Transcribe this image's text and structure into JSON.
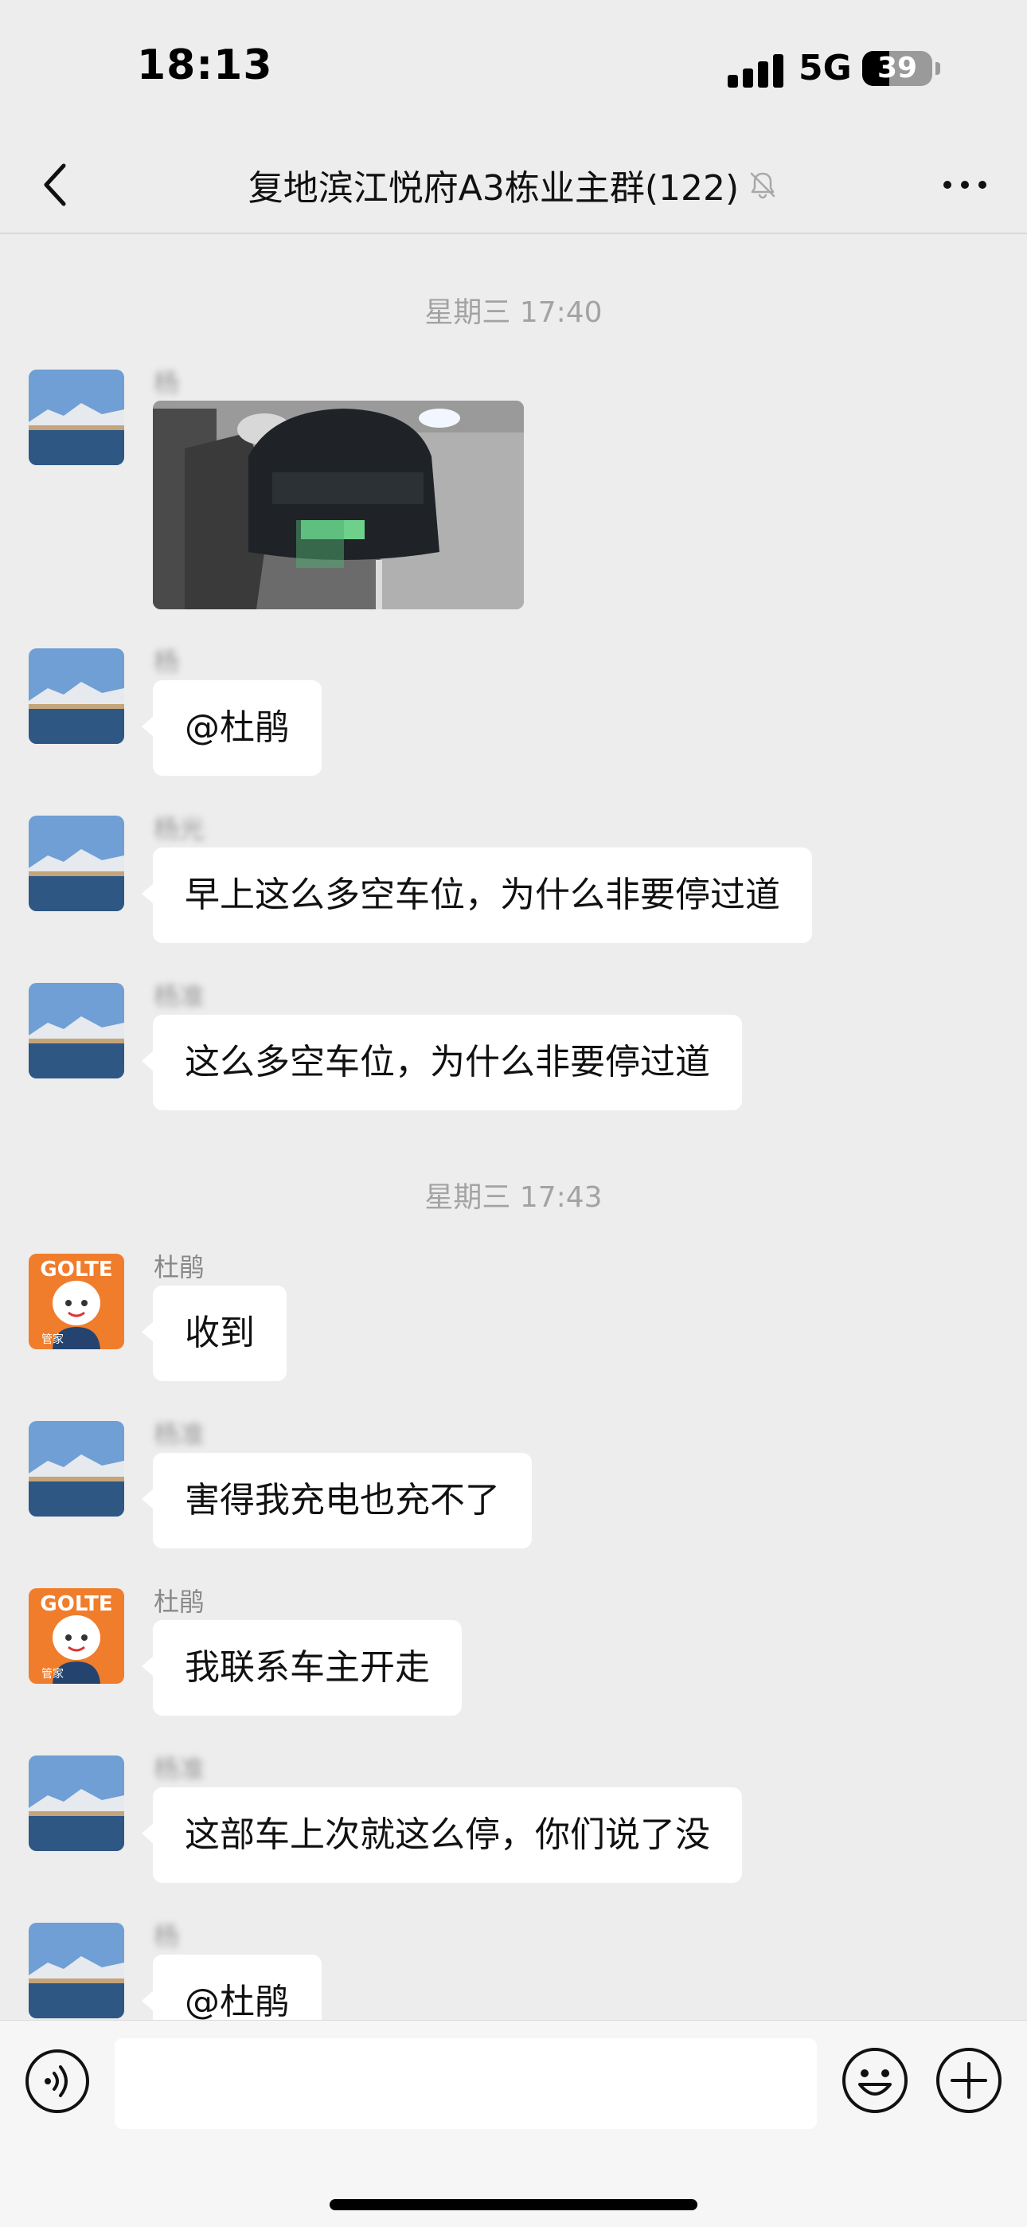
{
  "status_bar": {
    "time": "18:13",
    "network": "5G",
    "battery_level": "39",
    "battery_fraction": 0.39
  },
  "nav": {
    "back_icon": "chevron-left-icon",
    "title": "复地滨江悦府A3栋业主群(122)",
    "mute_icon": "bell-slash-icon",
    "more_icon": "ellipsis-icon"
  },
  "chat": {
    "timestamps": [
      "星期三 17:40",
      "星期三 17:43"
    ],
    "messages": [
      {
        "sender": "杨",
        "kind": "image"
      },
      {
        "sender": "杨",
        "text": "@杜鹃"
      },
      {
        "sender": "杨光",
        "text": "早上这么多空车位，为什么非要停过道"
      },
      {
        "sender": "杨准",
        "text": "这么多空车位，为什么非要停过道"
      },
      {
        "sender": "杜鹃",
        "text": "收到"
      },
      {
        "sender": "杨准",
        "text": "害得我充电也充不了"
      },
      {
        "sender": "杜鹃",
        "text": "我联系车主开走"
      },
      {
        "sender": "杨准",
        "text": "这部车上次就这么停，你们说了没"
      },
      {
        "sender": "杨",
        "text": "@杜鹃"
      }
    ],
    "bot_avatar": {
      "brand": "GOLTE",
      "badge": "管家"
    }
  },
  "input_bar": {
    "voice_icon": "voice-icon",
    "input_value": "",
    "emoji_icon": "emoji-icon",
    "plus_icon": "plus-circle-icon"
  }
}
